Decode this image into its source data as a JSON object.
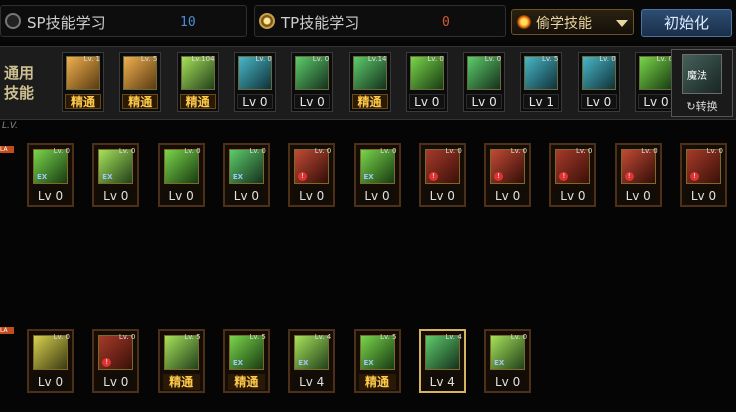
{
  "tabs": [
    {
      "label": "SP技能学习",
      "count": "10",
      "count_color": "#4a8fd6"
    },
    {
      "label": "TP技能学习",
      "count": "0",
      "count_color": "#d65a3a"
    }
  ],
  "steal_skill": {
    "label": "偷学技能"
  },
  "reset_button": {
    "label": "初始化"
  },
  "common_section": {
    "label": "通用技能"
  },
  "swap_button": {
    "label": "转换",
    "tag": "魔法"
  },
  "level_header": "L.V.",
  "row_markers": [
    "LA",
    "LA"
  ],
  "common_skills": [
    {
      "tag": "Lv. 1",
      "level": "精通",
      "master": true,
      "art": "o1"
    },
    {
      "tag": "Lv. 5",
      "level": "精通",
      "master": true,
      "art": "o1"
    },
    {
      "tag": "Lv.104",
      "level": "精通",
      "master": true,
      "art": "g3"
    },
    {
      "tag": "Lv. 0",
      "level": "Lv 0",
      "master": false,
      "art": "b1"
    },
    {
      "tag": "Lv. 0",
      "level": "Lv 0",
      "master": false,
      "art": "g2"
    },
    {
      "tag": "Lv.14",
      "level": "精通",
      "master": true,
      "art": "g2"
    },
    {
      "tag": "Lv. 0",
      "level": "Lv 0",
      "master": false,
      "art": "g1"
    },
    {
      "tag": "Lv. 0",
      "level": "Lv 0",
      "master": false,
      "art": "g2"
    },
    {
      "tag": "Lv. 5",
      "level": "Lv 1",
      "master": false,
      "art": "b1"
    },
    {
      "tag": "Lv. 0",
      "level": "Lv 0",
      "master": false,
      "art": "b1"
    },
    {
      "tag": "Lv. 0",
      "level": "Lv 0",
      "master": false,
      "art": "g1"
    }
  ],
  "class_skills_row1": [
    {
      "tag": "Lv. 0",
      "level": "Lv 0",
      "master": false,
      "art": "g1",
      "mark": "EX"
    },
    {
      "tag": "Lv. 0",
      "level": "Lv 0",
      "master": false,
      "art": "g3",
      "mark": "EX"
    },
    {
      "tag": "Lv. 0",
      "level": "Lv 0",
      "master": false,
      "art": "g1",
      "mark": ""
    },
    {
      "tag": "Lv. 0",
      "level": "Lv 0",
      "master": false,
      "art": "g2",
      "mark": "EX"
    },
    {
      "tag": "Lv. 0",
      "level": "Lv 0",
      "master": false,
      "art": "r2",
      "mark": "!"
    },
    {
      "tag": "Lv. 0",
      "level": "Lv 0",
      "master": false,
      "art": "g1",
      "mark": "EX"
    },
    {
      "tag": "Lv. 0",
      "level": "Lv 0",
      "master": false,
      "art": "r1",
      "mark": "!"
    },
    {
      "tag": "Lv. 0",
      "level": "Lv 0",
      "master": false,
      "art": "r2",
      "mark": "!"
    },
    {
      "tag": "Lv. 0",
      "level": "Lv 0",
      "master": false,
      "art": "r1",
      "mark": "!"
    },
    {
      "tag": "Lv. 0",
      "level": "Lv 0",
      "master": false,
      "art": "r2",
      "mark": "!"
    },
    {
      "tag": "Lv. 0",
      "level": "Lv 0",
      "master": false,
      "art": "r1",
      "mark": "!"
    }
  ],
  "class_skills_row2": [
    {
      "tag": "Lv. 0",
      "level": "Lv 0",
      "master": false,
      "art": "y1",
      "mark": ""
    },
    {
      "tag": "Lv. 0",
      "level": "Lv 0",
      "master": false,
      "art": "r1",
      "mark": "!"
    },
    {
      "tag": "Lv. 5",
      "level": "精通",
      "master": true,
      "art": "g3",
      "mark": ""
    },
    {
      "tag": "Lv. 5",
      "level": "精通",
      "master": true,
      "art": "g1",
      "mark": "EX"
    },
    {
      "tag": "Lv. 4",
      "level": "Lv 4",
      "master": false,
      "art": "g3",
      "mark": "EX"
    },
    {
      "tag": "Lv. 5",
      "level": "精通",
      "master": true,
      "art": "g1",
      "mark": "EX"
    },
    {
      "tag": "Lv. 4",
      "level": "Lv 4",
      "master": false,
      "art": "g2",
      "mark": "",
      "active": true
    },
    {
      "tag": "Lv. 0",
      "level": "Lv 0",
      "master": false,
      "art": "g3",
      "mark": "EX"
    }
  ]
}
